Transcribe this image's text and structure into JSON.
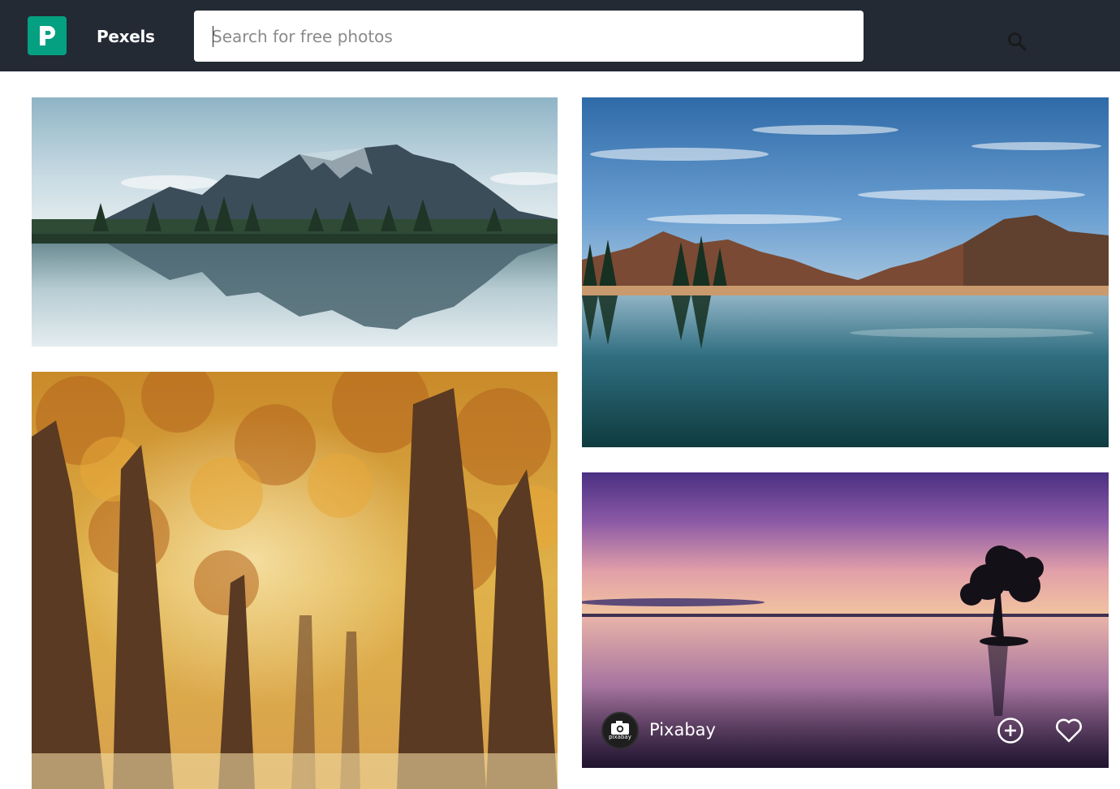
{
  "header": {
    "brand": "Pexels",
    "logo_icon": "pexels-logo-icon",
    "search": {
      "placeholder": "Search for free photos",
      "value": ""
    },
    "search_icon": "search-icon"
  },
  "colors": {
    "header_bg": "#232a34",
    "brand_green": "#05a081",
    "page_bg": "#ffffff"
  },
  "photos": [
    {
      "subject": "mountain-lake-reflection"
    },
    {
      "subject": "alpine-lake-blue-sky"
    },
    {
      "subject": "autumn-forest-path"
    },
    {
      "subject": "sunset-lake-tree",
      "author": "Pixabay",
      "avatar_text": "pixabay",
      "actions": [
        "collect-icon",
        "like-icon"
      ]
    }
  ]
}
